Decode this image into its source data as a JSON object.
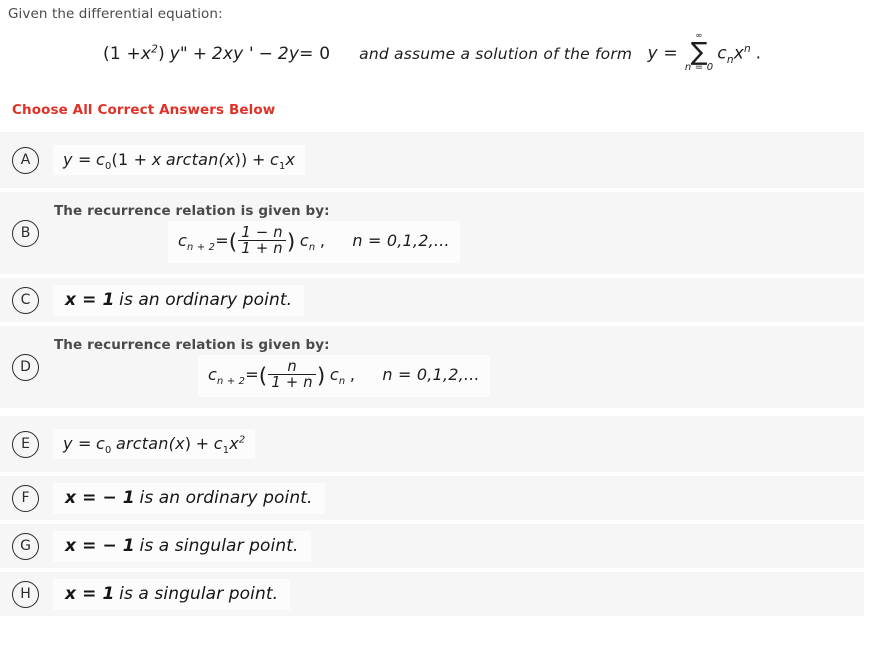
{
  "stem": {
    "intro": "Given the differential equation:",
    "equation": {
      "lhs_a": "(1 +",
      "lhs_x": "x",
      "lhs_exp": "2",
      "lhs_b": ")",
      "y_dblprime": "y\"",
      "plus": "+",
      "term2": "2xy '",
      "minus": "−",
      "term3": "2y",
      "equals": "= 0",
      "connector": "and  assume a solution of the form",
      "y_equals": "y =",
      "sum_top": "∞",
      "sum_symbol": "∑",
      "sum_bottom": "n = 0",
      "sum_term_c": "c",
      "sum_term_n": "n",
      "sum_term_x": "x",
      "sum_term_exp": "n",
      "period": "."
    }
  },
  "heading": {
    "text": "Choose All Correct Answers Below",
    "color": "#e03127"
  },
  "options": [
    {
      "letter": "A",
      "type": "formula",
      "intro": null,
      "formula": {
        "kind": "solution",
        "y": "y =",
        "c0": "c",
        "c0_sub": "0",
        "open": "(1 +",
        "x1": "x",
        "arctan": "arctan(",
        "x2": "x",
        "close": "))",
        "plus": "+",
        "c1": "c",
        "c1_sub": "1",
        "x3": "x",
        "x3_exp": ""
      },
      "text_plain": "y = c0(1 + x arctan(x)) + c1 x"
    },
    {
      "letter": "B",
      "type": "recurrence",
      "intro": "The recurrence relation is given by:",
      "formula": {
        "kind": "recurrence",
        "c": "c",
        "c_sub": "n + 2",
        "equals": "=",
        "paren_open": "(",
        "numerator": "1 − n",
        "denominator": "1 + n",
        "paren_close": ")",
        "cn": "c",
        "cn_sub": "n",
        "comma": ",",
        "range": "n = 0,1,2,..."
      },
      "text_plain": "c(n+2) = ((1 - n)/(1 + n)) c(n) ,   n = 0,1,2,..."
    },
    {
      "letter": "C",
      "type": "statement",
      "intro": null,
      "statement_lead": "x = 1",
      "statement_rest": "is an ordinary point.",
      "text_plain": "x = 1 is an ordinary point."
    },
    {
      "letter": "D",
      "type": "recurrence",
      "intro": "The recurrence relation is given by:",
      "formula": {
        "kind": "recurrence",
        "c": "c",
        "c_sub": "n + 2",
        "equals": "=",
        "paren_open": "(",
        "numerator": "n",
        "denominator": "1 + n",
        "paren_close": ")",
        "cn": "c",
        "cn_sub": "n",
        "comma": ",",
        "range": "n = 0,1,2,..."
      },
      "text_plain": "c(n+2) = (n/(1 + n)) c(n) ,   n = 0,1,2,..."
    },
    {
      "letter": "E",
      "type": "formula",
      "intro": null,
      "formula": {
        "kind": "solution",
        "y": "y =",
        "c0": "c",
        "c0_sub": "0",
        "open": "",
        "x1": "",
        "arctan": "arctan(",
        "x2": "x",
        "close": ")",
        "plus": "+",
        "c1": "c",
        "c1_sub": "1",
        "x3": "x",
        "x3_exp": "2"
      },
      "text_plain": "y = c0 arctan(x) + c1 x^2"
    },
    {
      "letter": "F",
      "type": "statement",
      "intro": null,
      "statement_lead": "x = − 1",
      "statement_rest": "is an ordinary point.",
      "text_plain": "x = -1 is an ordinary point."
    },
    {
      "letter": "G",
      "type": "statement",
      "intro": null,
      "statement_lead": "x = − 1",
      "statement_rest": "is a singular point.",
      "text_plain": "x = -1 is a singular point."
    },
    {
      "letter": "H",
      "type": "statement",
      "intro": null,
      "statement_lead": "x = 1",
      "statement_rest": "is a singular point.",
      "text_plain": "x = 1 is a singular point."
    }
  ]
}
